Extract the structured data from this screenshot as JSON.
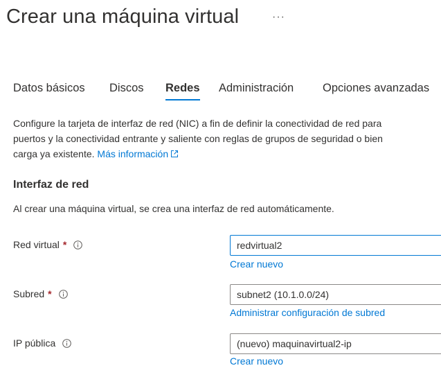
{
  "header": {
    "title": "Crear una máquina virtual",
    "more_label": "···"
  },
  "tabs": [
    {
      "label": "Datos básicos",
      "active": false
    },
    {
      "label": "Discos",
      "active": false
    },
    {
      "label": "Redes",
      "active": true
    },
    {
      "label": "Administración",
      "active": false
    },
    {
      "label": "Opciones avanzadas",
      "active": false
    }
  ],
  "description": {
    "line1": "Configure la tarjeta de interfaz de red (NIC) a fin de definir la conectividad de red para",
    "line2": "puertos y la conectividad entrante y saliente con reglas de grupos de seguridad o bien",
    "line3": "carga ya existente.",
    "more_info_link": "Más información",
    "external_icon": "external-link-icon"
  },
  "network_interface": {
    "title": "Interfaz de red",
    "description": "Al crear una máquina virtual, se crea una interfaz de red automáticamente."
  },
  "fields": {
    "virtual_network": {
      "label": "Red virtual",
      "required": "*",
      "value": "redvirtual2",
      "link": "Crear nuevo"
    },
    "subnet": {
      "label": "Subred",
      "required": "*",
      "value": "subnet2 (10.1.0.0/24)",
      "link": "Administrar configuración de subred"
    },
    "public_ip": {
      "label": "IP pública",
      "value": "(nuevo) maquinavirtual2-ip",
      "link": "Crear nuevo"
    }
  },
  "colors": {
    "accent": "#0078d4",
    "required": "#a4262c",
    "text": "#323130",
    "border": "#8a8886"
  }
}
